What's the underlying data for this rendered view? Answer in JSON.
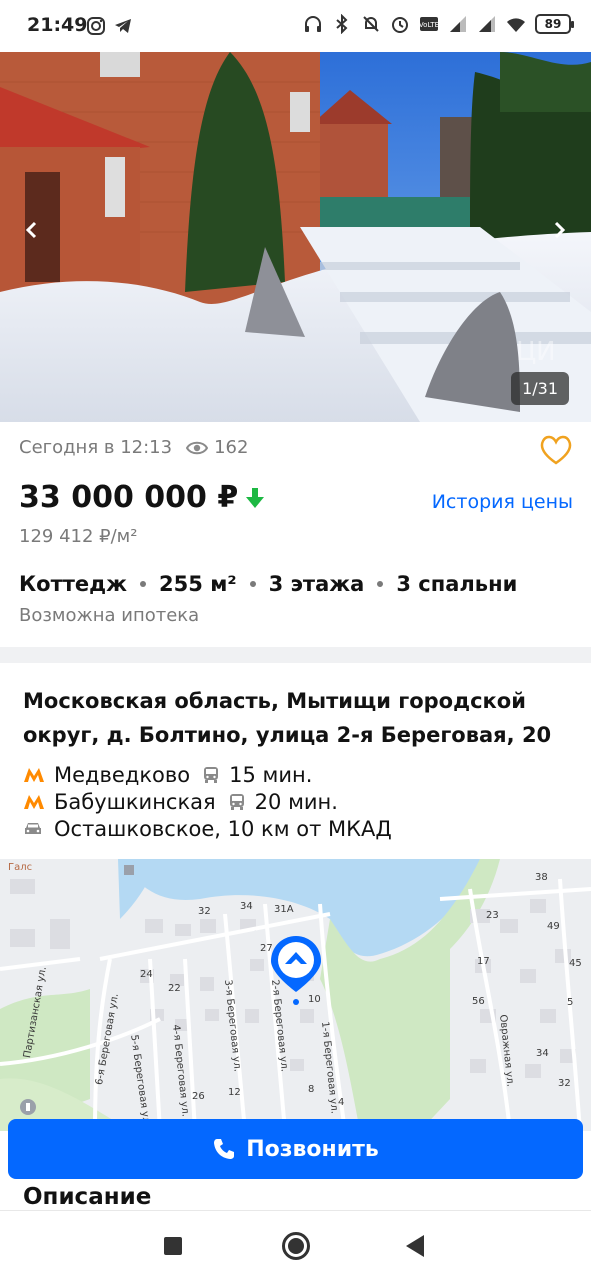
{
  "status_bar": {
    "time": "21:49",
    "battery": "89",
    "left_icons": [
      "instagram-icon",
      "telegram-icon"
    ],
    "right_icons": [
      "headphones-icon",
      "bluetooth-icon",
      "bell-off-icon",
      "alarm-icon",
      "volte-icon",
      "signal-icon",
      "signal-icon",
      "wifi-icon",
      "battery-icon"
    ]
  },
  "gallery": {
    "counter": "1/31",
    "watermark": "ЦИ"
  },
  "listing": {
    "published": "Сегодня в 12:13",
    "views": "162",
    "price": "33 000 000 ₽",
    "price_history_link": "История цены",
    "price_per_sqm": "129 412 ₽/м²",
    "specs": [
      "Коттедж",
      "255 м²",
      "3 этажа",
      "3 спальни"
    ],
    "mortgage": "Возможна ипотека"
  },
  "location": {
    "address": "Московская область, Мытищи городской округ, д. Болтино, улица 2-я Береговая, 20",
    "metro": [
      {
        "station": "Медведково",
        "time": "15 мин."
      },
      {
        "station": "Бабушкинская",
        "time": "20 мин."
      }
    ],
    "highway": "Осташковское, 10 км от МКАД"
  },
  "map": {
    "labels": {
      "gals": "Галс",
      "partizanskaya": "Партизанская ул.",
      "ber6": "6-я Береговая ул.",
      "ber5": "5-я Береговая ул.",
      "ber4": "4-я Береговая ул.",
      "ber3": "3-я Береговая ул.",
      "ber2": "2-я Береговая ул.",
      "ber1": "1-я Береговая ул.",
      "ovrazh": "Овражная ул.",
      "n32": "32",
      "n34": "34",
      "n31a": "31А",
      "n27": "27",
      "n10": "10",
      "n24": "24",
      "n22": "22",
      "n23": "23",
      "n17": "17",
      "n49": "49",
      "n45": "45",
      "n56": "56",
      "n38": "38",
      "n8": "8",
      "n34b": "34",
      "n32b": "32",
      "n4": "4",
      "n12": "12",
      "n5": "5",
      "n26": "26"
    }
  },
  "actions": {
    "call": "Позвонить"
  },
  "description": {
    "title": "Описание"
  },
  "colors": {
    "accent": "#0468ff",
    "favorite": "#f0a21f",
    "price_down": "#1db843",
    "metro": "#ff8a00"
  }
}
